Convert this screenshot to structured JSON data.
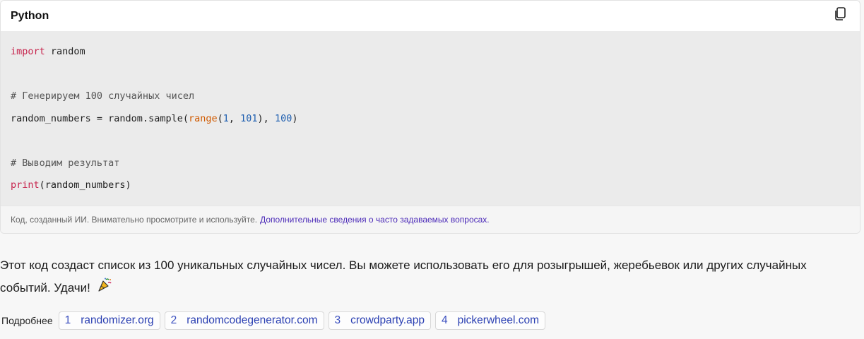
{
  "code_block": {
    "language": "Python",
    "copy_icon": "copy-icon",
    "lines": {
      "l1_kw": "import",
      "l1_rest": " random",
      "l2": "# Генерируем 100 случайных чисел",
      "l3_a": "random_numbers = random.sample(",
      "l3_fn": "range",
      "l3_b": "(",
      "l3_n1": "1",
      "l3_c": ", ",
      "l3_n2": "101",
      "l3_d": "), ",
      "l3_n3": "100",
      "l3_e": ")",
      "l4": "# Выводим результат",
      "l5_fn": "print",
      "l5_rest": "(random_numbers)"
    },
    "footer_text": "Код, созданный ИИ. Внимательно просмотрите и используйте.",
    "footer_link": "Дополнительные сведения о часто задаваемых вопросах."
  },
  "answer": {
    "text": "Этот код создаст список из 100 уникальных случайных чисел. Вы можете использовать его для розыгрышей, жеребьевок или других случайных событий. Удачи!",
    "emoji_icon": "party-popper-icon"
  },
  "sources": {
    "label": "Подробнее",
    "items": [
      {
        "index": "1",
        "label": "randomizer.org"
      },
      {
        "index": "2",
        "label": "randomcodegenerator.com"
      },
      {
        "index": "3",
        "label": "crowdparty.app"
      },
      {
        "index": "4",
        "label": "pickerwheel.com"
      }
    ]
  },
  "colors": {
    "keyword": "#c7254e",
    "builtin": "#d05a00",
    "number": "#1f5fb0",
    "link": "#4b2ab8",
    "chip_text": "#2a3fb2"
  }
}
